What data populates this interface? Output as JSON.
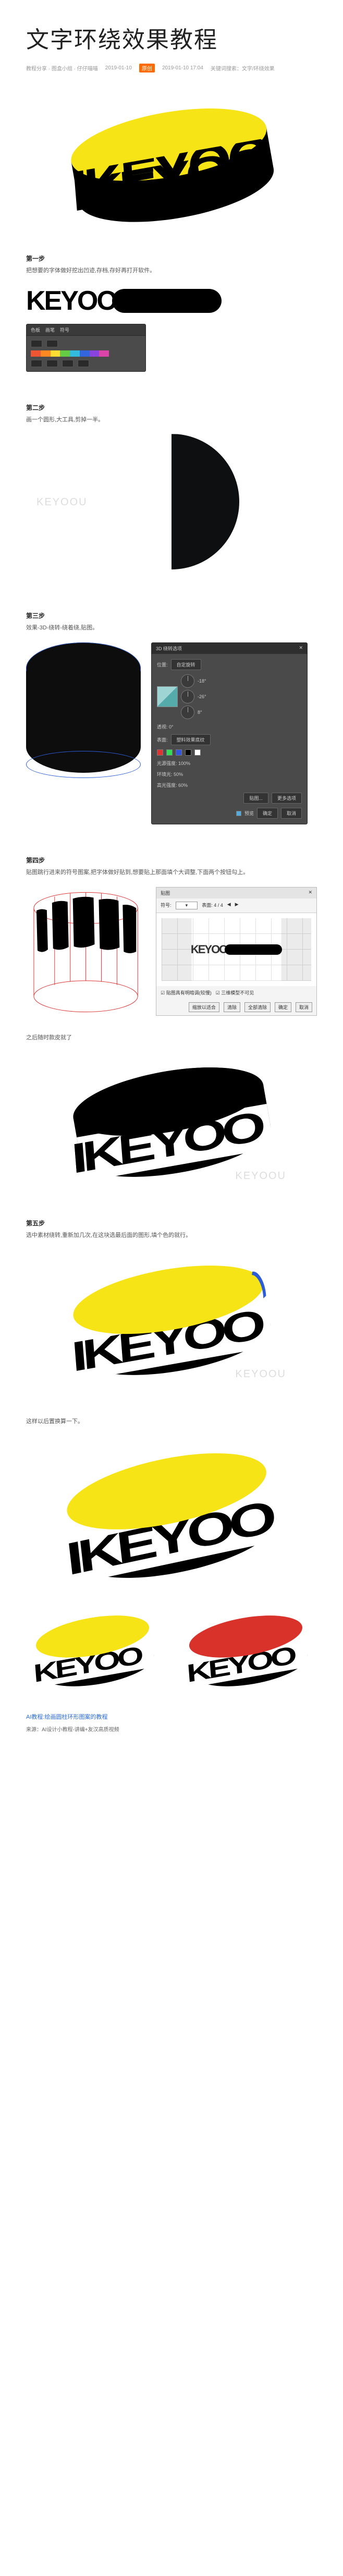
{
  "title": "文字环绕效果教程",
  "meta": {
    "source": "教程分享 · 图盒小组 · 仔仔喵喵",
    "date": "2019-01-10",
    "badge": "原创",
    "time": "2019-01-10 17:04",
    "right": "关键词搜索：文字/环绕效果"
  },
  "steps": [
    {
      "label": "第一步",
      "desc": "把想要的字体做好挖出凹迹,存档,存好再打开软件。"
    },
    {
      "label": "第二步",
      "desc": "画一个圆形,大工具,剪掉一半。"
    },
    {
      "label": "第三步",
      "desc": "效果-3D-绕转-绕着绕,贴图。"
    },
    {
      "label": "第四步",
      "desc": "贴图跳行进来的符号图案,把字体做好贴到,想要贴上那面填个大调整,下面两个按钮勾上。"
    },
    {
      "label": "之后随时款皮就了"
    },
    {
      "label": "第五步",
      "desc": "选中素材绕转,重新加几次,在这块选最后面的图形,填个色的就行。"
    },
    {
      "label": "这样以后置换算一下。"
    }
  ],
  "panel_sm": {
    "tabs": [
      "色板",
      "画笔",
      "符号"
    ],
    "inputs": [
      "",
      "",
      ""
    ]
  },
  "panel3d": {
    "title": "3D 绕转选项",
    "pos": "位置:",
    "pos_val": "自定旋转",
    "angles": [
      "-18°",
      "-26°",
      "8°"
    ],
    "persp": "透视: 0°",
    "surface": "表面:",
    "surface_val": "塑料效果底纹",
    "light": "光源强度: 100%",
    "ambient": "环境光: 50%",
    "highlight": "高光强度: 60%",
    "buttons": [
      "贴图...",
      "更多选项",
      "预览",
      "确定",
      "取消"
    ]
  },
  "mapart": {
    "title": "贴图",
    "sym": "符号:",
    "surf": "表面: 4 / 4",
    "chk1": "贴图具有明暗调(较慢)",
    "chk2": "三维模型不可见",
    "buttons": [
      "缩放以适合",
      "清除",
      "全部清除",
      "确定",
      "取消"
    ]
  },
  "keytext": "KEYOO",
  "watermark": "KEYOOU",
  "footer": {
    "link": "AI教程:绘画圆柱环形图案的教程",
    "source": "来源：AI设计小教程-讲编+友汉高质视频"
  },
  "colors": {
    "yellow": "#f7e416",
    "red": "#d8322a",
    "blue": "#2c5dd6"
  }
}
